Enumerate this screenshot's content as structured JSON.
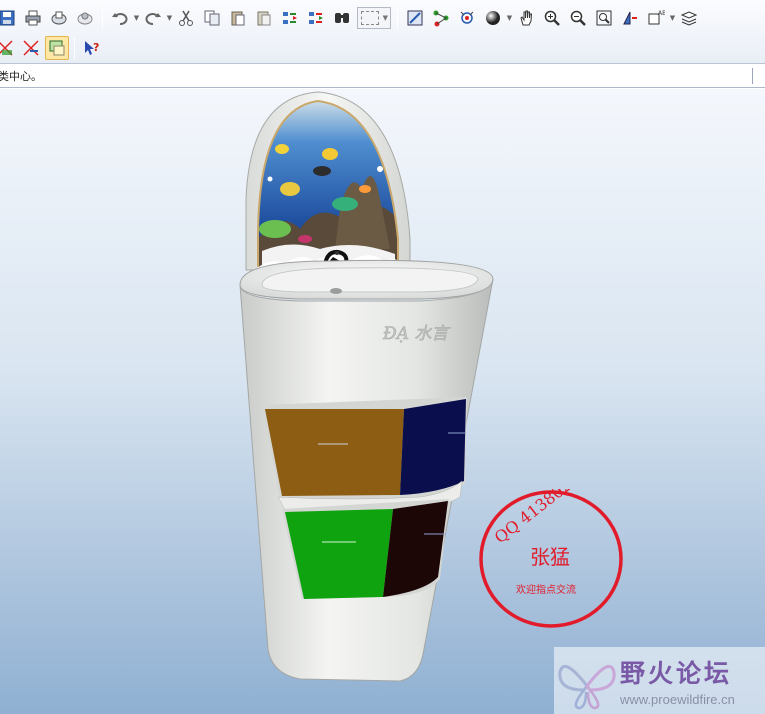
{
  "toolbar": {
    "row1": [
      {
        "name": "save-icon",
        "label": "Save"
      },
      {
        "name": "print-icon",
        "label": "Print"
      },
      {
        "name": "send-mail-icon",
        "label": "Send"
      },
      {
        "name": "send-link-icon",
        "label": "Send link"
      },
      {
        "name": "undo-icon",
        "label": "Undo"
      },
      {
        "name": "redo-icon",
        "label": "Redo"
      },
      {
        "name": "cut-icon",
        "label": "Cut"
      },
      {
        "name": "copy-icon",
        "label": "Copy"
      },
      {
        "name": "paste-icon",
        "label": "Paste"
      },
      {
        "name": "paste-special-icon",
        "label": "Paste special"
      },
      {
        "name": "regenerate-icon",
        "label": "Regenerate"
      },
      {
        "name": "regenerate-manager-icon",
        "label": "Regenerate manager"
      },
      {
        "name": "find-icon",
        "label": "Find"
      },
      {
        "name": "select-box-icon",
        "label": "Select"
      },
      {
        "name": "sketch-view-icon",
        "label": "Sketch"
      },
      {
        "name": "datum-display-icon",
        "label": "Datum"
      },
      {
        "name": "spin-center-icon",
        "label": "Spin center"
      },
      {
        "name": "shading-icon",
        "label": "Shading"
      },
      {
        "name": "pan-hand-icon",
        "label": "Pan"
      },
      {
        "name": "zoom-in-icon",
        "label": "Zoom in"
      },
      {
        "name": "zoom-out-icon",
        "label": "Zoom out"
      },
      {
        "name": "refit-icon",
        "label": "Refit"
      },
      {
        "name": "reorient-icon",
        "label": "Reorient"
      },
      {
        "name": "saved-views-icon",
        "label": "Saved views"
      },
      {
        "name": "layers-icon",
        "label": "Layers"
      }
    ],
    "row2": [
      {
        "name": "datum-planes-icon",
        "label": "Datum planes"
      },
      {
        "name": "datum-axes-icon",
        "label": "Datum axes"
      },
      {
        "name": "view-manager-icon",
        "label": "View manager"
      },
      {
        "name": "whats-this-icon",
        "label": "What's this"
      }
    ]
  },
  "message_bar": {
    "text": "类中心。"
  },
  "model": {
    "brand_emboss": "ĐẠ 水言",
    "drawer_colors": {
      "top_left": "#8c5d12",
      "top_right": "#0a0e4c",
      "bottom_left": "#0fa30f",
      "bottom_right": "#1c0606"
    }
  },
  "stamp": {
    "qq": "QQ  413802742",
    "name": "张猛",
    "slogan": "欢迎指点交流",
    "color": "#e21b2a"
  },
  "watermark": {
    "title": "野火论坛",
    "url": "www.proewildfire.cn"
  }
}
